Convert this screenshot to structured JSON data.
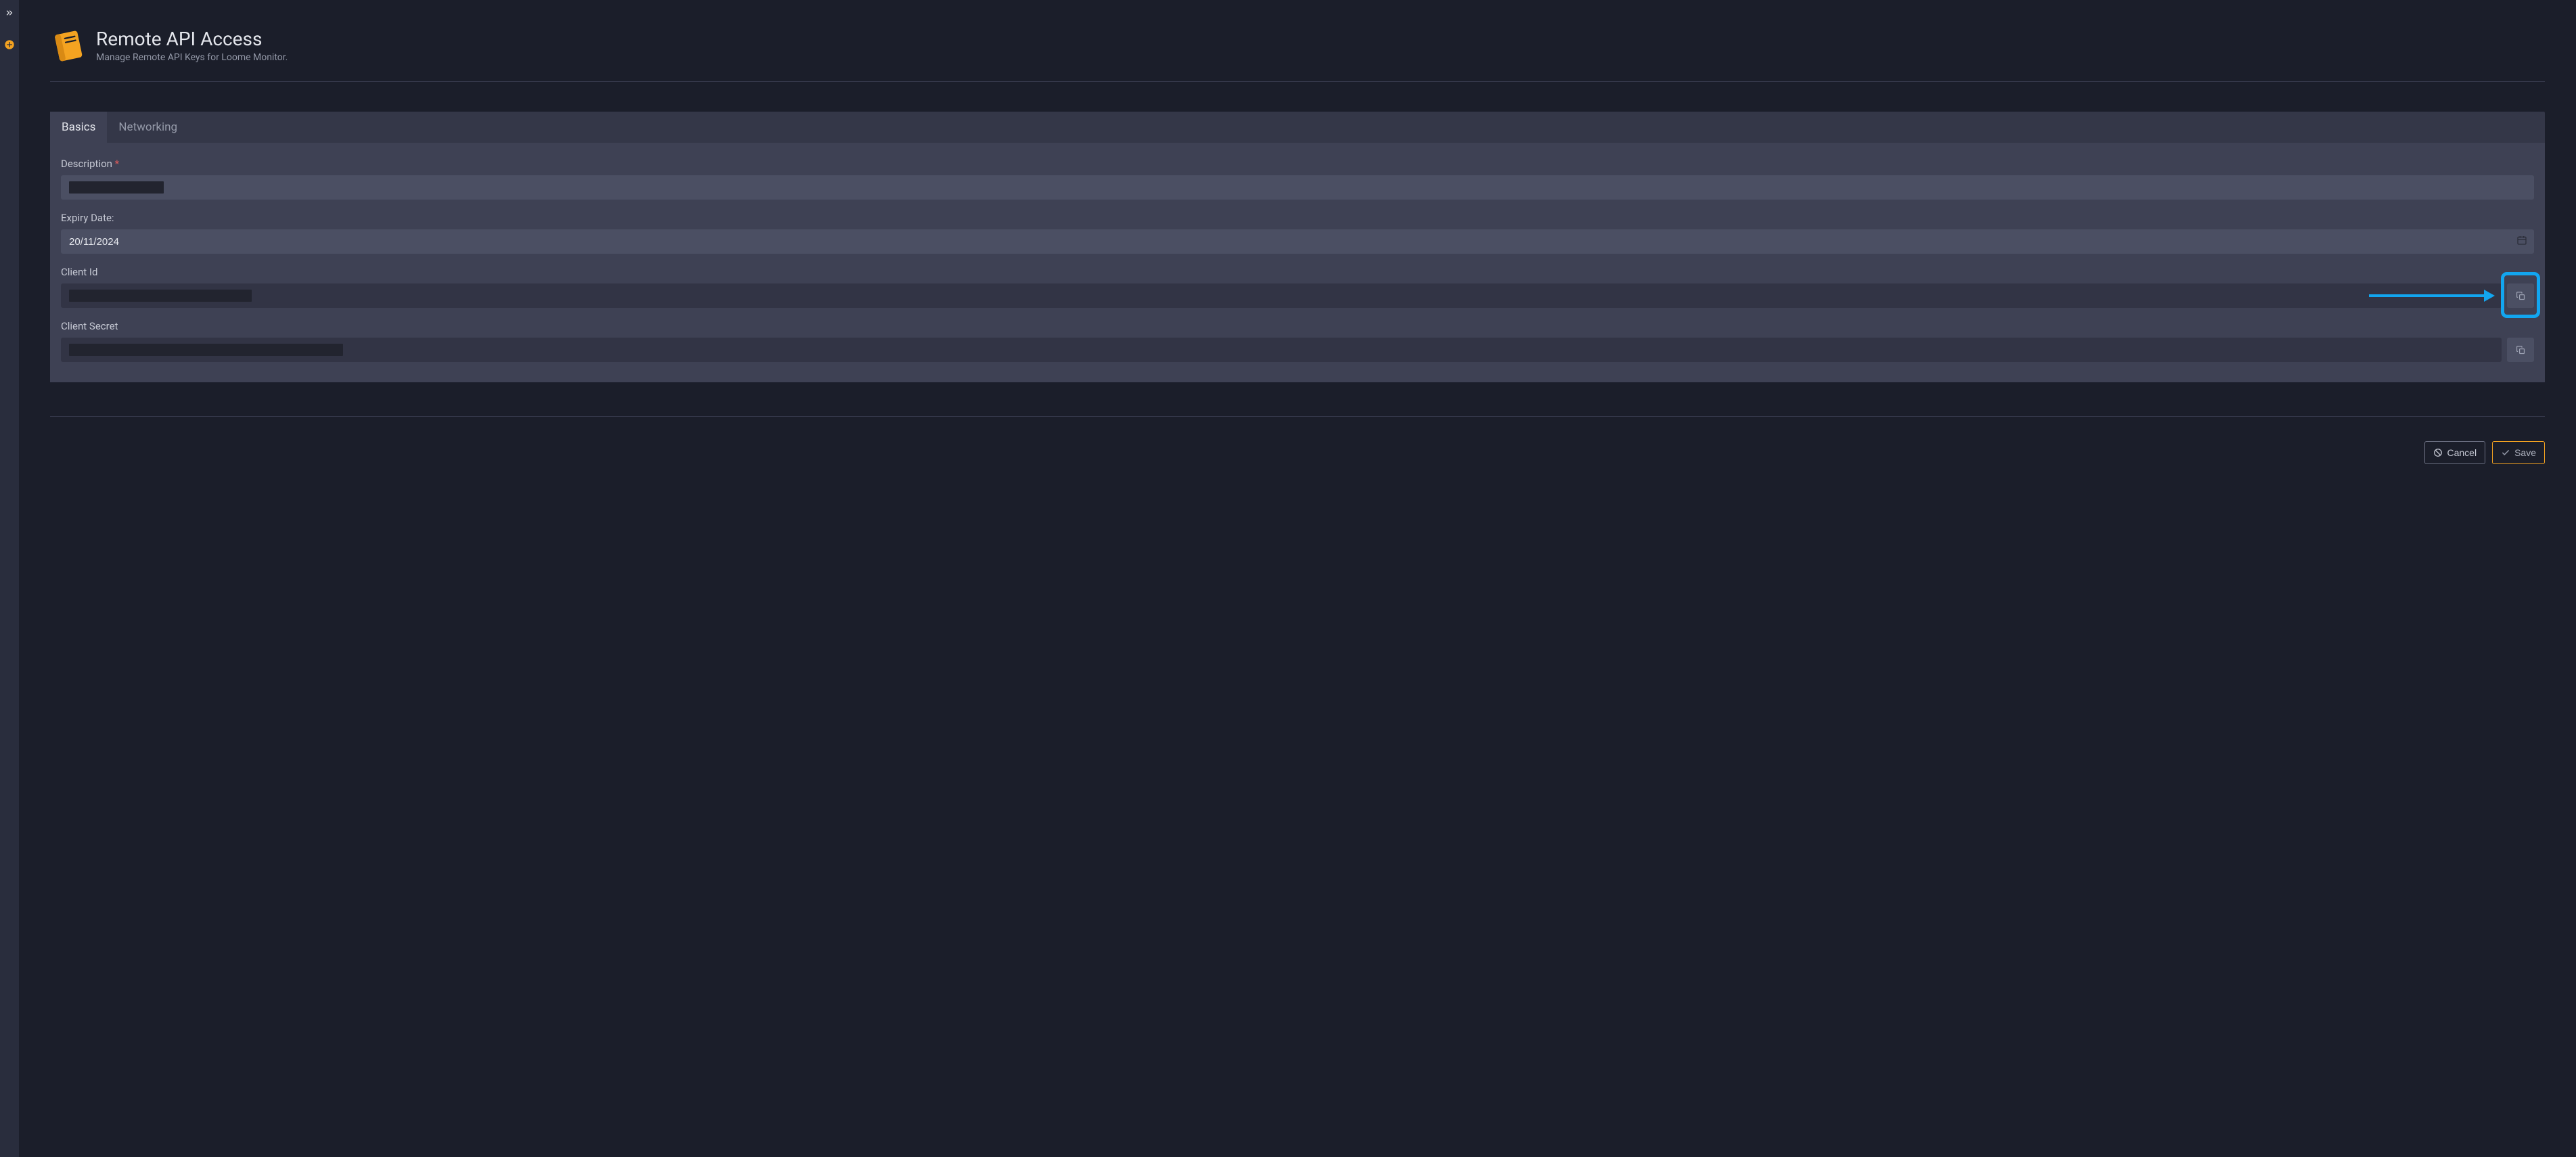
{
  "header": {
    "title": "Remote API Access",
    "subtitle": "Manage Remote API Keys for Loome Monitor."
  },
  "tabs": [
    {
      "label": "Basics",
      "active": true
    },
    {
      "label": "Networking",
      "active": false
    }
  ],
  "form": {
    "description": {
      "label": "Description",
      "required": true,
      "value": ""
    },
    "expiry": {
      "label": "Expiry Date:",
      "value": "20/11/2024"
    },
    "clientId": {
      "label": "Client Id",
      "value": ""
    },
    "clientSecret": {
      "label": "Client Secret",
      "value": ""
    }
  },
  "buttons": {
    "cancel": "Cancel",
    "save": "Save"
  },
  "icons": {
    "expand": "chevrons-right",
    "add": "plus-circle",
    "book": "book",
    "calendar": "calendar",
    "copy": "copy",
    "cancel": "slash-circle",
    "save": "check"
  }
}
